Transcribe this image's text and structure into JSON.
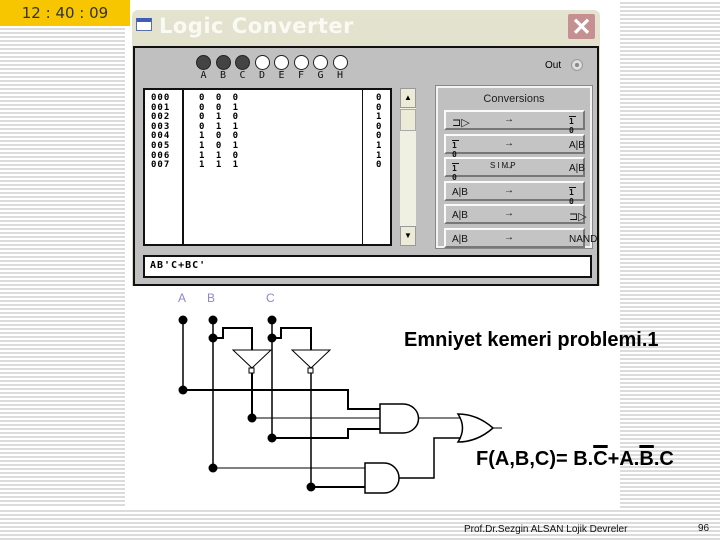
{
  "clock": "12  : 40 : 09",
  "window": {
    "title": "Logic Converter",
    "close_icon": "close-icon",
    "inputs": [
      {
        "label": "A",
        "on": true
      },
      {
        "label": "B",
        "on": true
      },
      {
        "label": "C",
        "on": true
      },
      {
        "label": "D",
        "on": false
      },
      {
        "label": "E",
        "on": false
      },
      {
        "label": "F",
        "on": false
      },
      {
        "label": "G",
        "on": false
      },
      {
        "label": "H",
        "on": false
      }
    ],
    "out_label": "Out",
    "truth_table": {
      "rows": [
        {
          "idx": "000",
          "in": "0 0 0",
          "out": "0"
        },
        {
          "idx": "001",
          "in": "0 0 1",
          "out": "0"
        },
        {
          "idx": "002",
          "in": "0 1 0",
          "out": "1"
        },
        {
          "idx": "003",
          "in": "0 1 1",
          "out": "0"
        },
        {
          "idx": "004",
          "in": "1 0 0",
          "out": "0"
        },
        {
          "idx": "005",
          "in": "1 0 1",
          "out": "1"
        },
        {
          "idx": "006",
          "in": "1 1 0",
          "out": "1"
        },
        {
          "idx": "007",
          "in": "1 1 1",
          "out": "0"
        }
      ]
    },
    "scroll_up": "▲",
    "scroll_down": "▼",
    "conversions": {
      "title": "Conversions",
      "buttons": [
        {
          "name": "circuit-to-truth-table",
          "left": "gate",
          "arrow": "→",
          "right": "1 0 | 1"
        },
        {
          "name": "truth-table-to-expression",
          "left": "1 0 | 1",
          "arrow": "→",
          "right": "A|B"
        },
        {
          "name": "truth-table-to-simplified-expression",
          "left": "1 0 | 1",
          "arrow": "→",
          "simp": "SIMP",
          "right": "A|B"
        },
        {
          "name": "expression-to-truth-table",
          "left": "A|B",
          "arrow": "→",
          "right": "1 0 | 1"
        },
        {
          "name": "expression-to-circuit",
          "left": "A|B",
          "arrow": "→",
          "right": "gate"
        },
        {
          "name": "expression-to-nand",
          "left": "A|B",
          "arrow": "→",
          "right": "NAND"
        }
      ]
    },
    "expression": "AB'C+BC'"
  },
  "circuit": {
    "input_labels": [
      "A",
      "B",
      "C"
    ]
  },
  "slide": {
    "heading": "Emniyet kemeri problemi.1",
    "formula_prefix": "F(A,B,C)= B.",
    "formula_cbar": "C",
    "formula_mid": "+A.",
    "formula_bbar": "B",
    "formula_suffix": ".C",
    "footer": "Prof.Dr.Sezgin ALSAN   Lojik Devreler",
    "page_number": "96"
  }
}
